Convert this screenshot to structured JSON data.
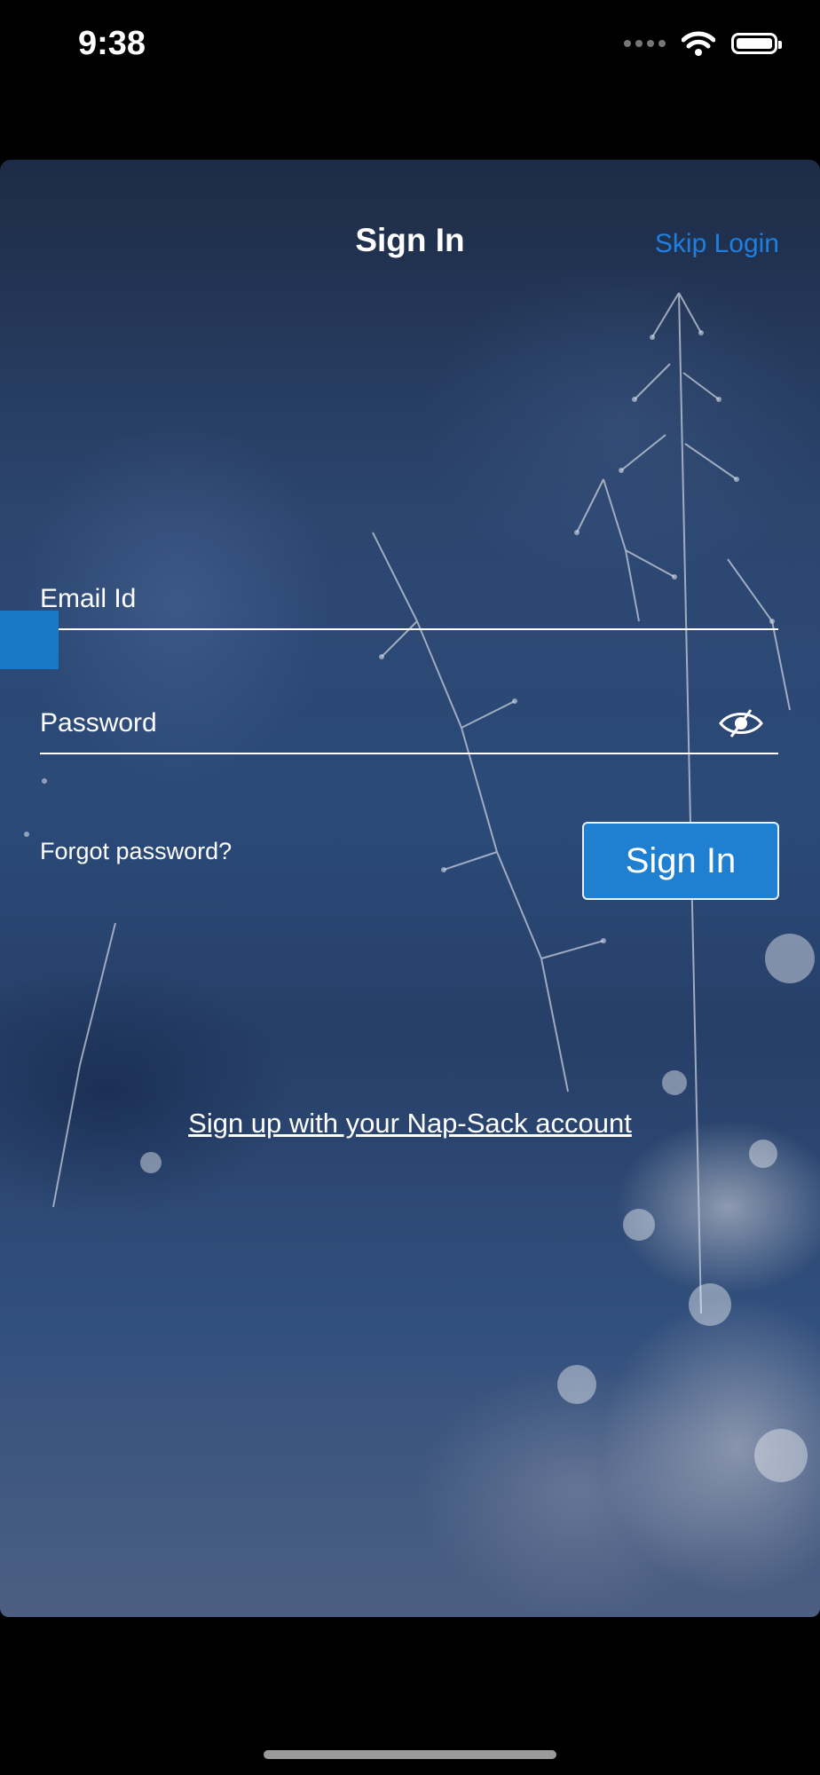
{
  "status_bar": {
    "time": "9:38"
  },
  "header": {
    "title": "Sign In",
    "skip_label": "Skip Login"
  },
  "form": {
    "email_label": "Email Id",
    "email_value": "",
    "password_label": "Password",
    "password_value": "",
    "forgot_label": "Forgot password?",
    "signin_label": "Sign In"
  },
  "signup_label": "Sign up with your Nap-Sack account",
  "colors": {
    "accent": "#1e7fe0",
    "button": "#1f7fd0",
    "background": "#2b4a78"
  },
  "icons": {
    "visibility": "eye-slash-icon",
    "wifi": "wifi-icon",
    "battery": "battery-icon",
    "signal": "signal-icon"
  }
}
